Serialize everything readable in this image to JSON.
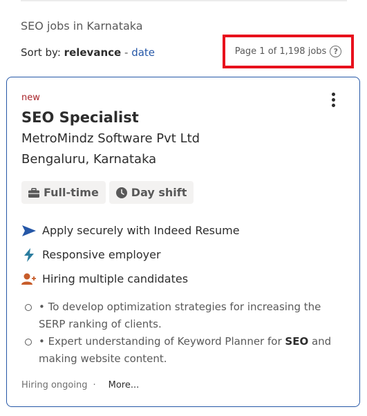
{
  "header": {
    "search_heading": "SEO jobs in Karnataka",
    "sort_prefix": "Sort by:",
    "sort_active": "relevance",
    "sort_separator": "-",
    "sort_alternative": "date",
    "page_info": "Page 1 of 1,198 jobs",
    "help_icon": "?"
  },
  "job": {
    "badge": "new",
    "title": "SEO Specialist",
    "company": "MetroMindz Software Pvt Ltd",
    "location": "Bengaluru, Karnataka",
    "tags": [
      {
        "label": "Full-time",
        "icon": "briefcase-icon"
      },
      {
        "label": "Day shift",
        "icon": "clock-icon"
      }
    ],
    "features": [
      {
        "label": "Apply securely with Indeed Resume",
        "icon": "send-arrow-icon",
        "color": "#2557a7"
      },
      {
        "label": "Responsive employer",
        "icon": "lightning-icon",
        "color": "#2b7d9f"
      },
      {
        "label": "Hiring multiple candidates",
        "icon": "person-add-icon",
        "color": "#c75c2a"
      }
    ],
    "snippet": [
      {
        "text": "• To develop optimization strategies for increasing the SERP ranking of clients."
      },
      {
        "before": "• Expert understanding of Keyword Planner for ",
        "bold": "SEO",
        "after": " and making website content."
      }
    ],
    "footer_status": "Hiring ongoing",
    "footer_separator": "·",
    "footer_more": "More..."
  },
  "colors": {
    "link_blue": "#2557a7",
    "highlight_red": "#e8101c",
    "new_badge": "#a9252b"
  }
}
